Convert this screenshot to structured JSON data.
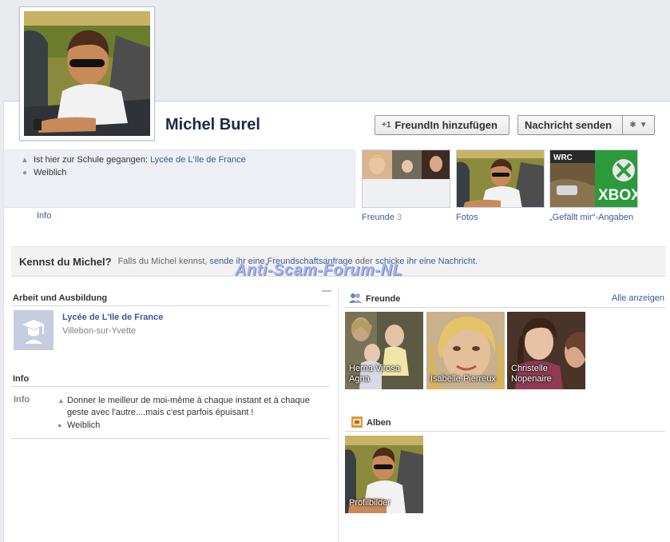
{
  "profile": {
    "name": "Michel Burel",
    "add_friend_label": "FreundIn hinzufügen",
    "send_message_label": "Nachricht senden"
  },
  "info_box": {
    "school_prefix": "Ist hier zur Schule gegangen:",
    "school_link": "Lycée de L'Ile de France",
    "gender": "Weiblich",
    "tab_label": "Info"
  },
  "thumbnails": {
    "friends_label": "Freunde",
    "friends_count": "3",
    "photos_label": "Fotos",
    "likes_label": "„Gefällt mir“-Angaben",
    "likes_brand_1": "WRC",
    "likes_brand_2": "XBOX"
  },
  "know_bar": {
    "title": "Kennst du Michel?",
    "part1": "Falls du Michel kennst, ",
    "link1": "sende ihr eine Freundschaftsanfrage",
    "part2": " oder ",
    "link2": "schicke ihr eine Nachricht",
    "part3": "."
  },
  "watermark": "Anti-Scam-Forum-NL",
  "work_education": {
    "heading": "Arbeit und Ausbildung",
    "school_name": "Lycée de L'Ile de France",
    "school_location": "Villebon-sur-Yvette"
  },
  "info_section": {
    "heading": "Info",
    "label": "Info",
    "bio": "Donner le meilleur de moi-même à chaque instant et à chaque geste avec l'autre....mais c'est parfois épuisant !",
    "gender": "Weiblich"
  },
  "friends_section": {
    "heading": "Freunde",
    "all_link": "Alle anzeigen",
    "friends": [
      {
        "line1": "Herna Virosa",
        "line2": "Agna"
      },
      {
        "line1": "Isabelle Pierreux",
        "line2": ""
      },
      {
        "line1": "Christelle",
        "line2": "Nopenaire"
      }
    ]
  },
  "albums_section": {
    "heading": "Alben",
    "album_name": "Profilbilder"
  },
  "colors": {
    "link": "#3b5998",
    "name": "#1c2a47",
    "info_bg": "#edeff4"
  }
}
